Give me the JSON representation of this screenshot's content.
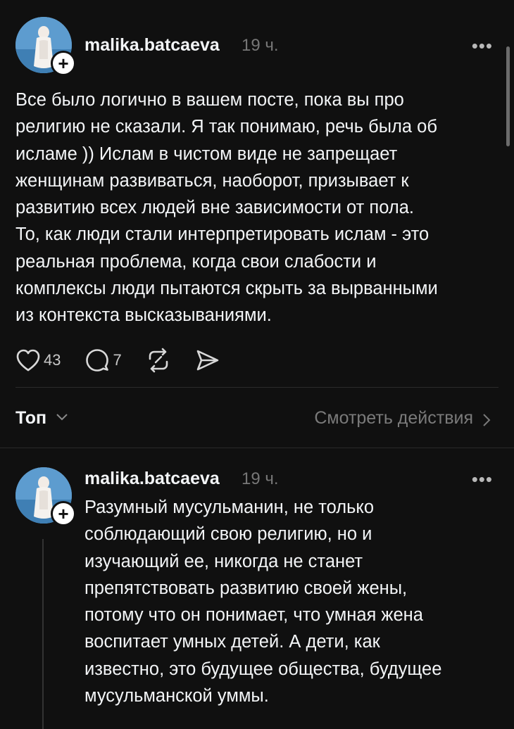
{
  "post": {
    "username": "malika.batcaeva",
    "time": "19 ч.",
    "more_label": "•••",
    "text": "Все было логично в вашем посте, пока вы про\nрелигию не сказали. Я так понимаю, речь была об\nисламе )) Ислам в чистом виде не запрещает\nженщинам развиваться, наоборот, призывает к\nразвитию всех людей вне зависимости от пола.\nТо, как люди стали интерпретировать ислам - это\nреальная проблема, когда свои слабости и\nкомплексы люди пытаются скрыть за вырванными\nиз контекста высказываниями.",
    "likes": "43",
    "comments": "7",
    "icons": {
      "like": "heart-icon",
      "comment": "comment-bubble-icon",
      "repost": "repost-icon",
      "share": "send-icon"
    }
  },
  "sort": {
    "label": "Топ",
    "activity_link": "Смотреть действия"
  },
  "reply": {
    "username": "malika.batcaeva",
    "time": "19 ч.",
    "more_label": "•••",
    "text": "Разумный мусульманин, не только\nсоблюдающий свою религию, но и\nизучающий ее, никогда не станет\nпрепятствовать развитию своей жены,\nпотому что он понимает, что умная жена\nвоспитает умных детей. А дети, как\nизвестно, это будущее общества, будущее\nмусульманской уммы."
  },
  "colors": {
    "background": "#101010",
    "text": "#f3f5f7",
    "muted": "#777777",
    "divider": "#2a2a2a"
  }
}
